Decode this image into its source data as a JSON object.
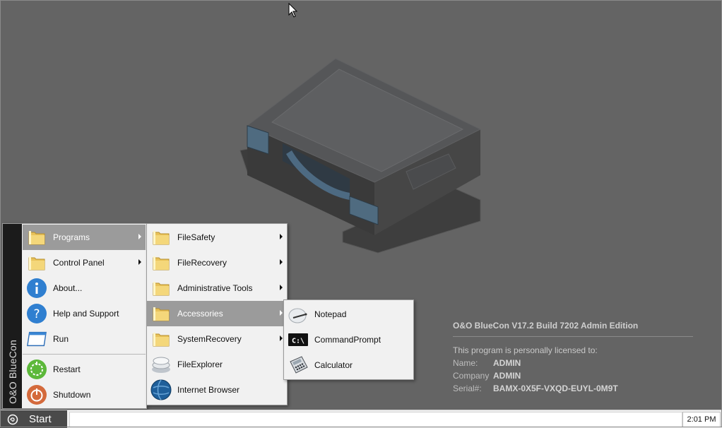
{
  "start_menu": {
    "brand": "O&O BlueCon",
    "items": [
      {
        "label": "Programs",
        "icon": "folder-icon",
        "has_submenu": true,
        "active": true
      },
      {
        "label": "Control Panel",
        "icon": "folder-icon",
        "has_submenu": true
      },
      {
        "label": "About...",
        "icon": "info-icon"
      },
      {
        "label": "Help and Support",
        "icon": "help-icon"
      },
      {
        "label": "Run",
        "icon": "run-window-icon"
      },
      {
        "label": "Restart",
        "icon": "restart-icon"
      },
      {
        "label": "Shutdown",
        "icon": "power-icon"
      }
    ]
  },
  "programs_menu": {
    "items": [
      {
        "label": "FileSafety",
        "icon": "folder-icon",
        "has_submenu": true
      },
      {
        "label": "FileRecovery",
        "icon": "folder-icon",
        "has_submenu": true
      },
      {
        "label": "Administrative Tools",
        "icon": "folder-icon",
        "has_submenu": true
      },
      {
        "label": "Accessories",
        "icon": "folder-icon",
        "has_submenu": true,
        "active": true
      },
      {
        "label": "SystemRecovery",
        "icon": "folder-icon",
        "has_submenu": true
      },
      {
        "label": "FileExplorer",
        "icon": "file-explorer-icon"
      },
      {
        "label": "Internet Browser",
        "icon": "globe-icon"
      }
    ]
  },
  "accessories_menu": {
    "items": [
      {
        "label": "Notepad",
        "icon": "notepad-icon"
      },
      {
        "label": "CommandPrompt",
        "icon": "command-prompt-icon"
      },
      {
        "label": "Calculator",
        "icon": "calculator-icon"
      }
    ]
  },
  "license": {
    "title": "O&O BlueCon V17.2 Build 7202 Admin Edition",
    "licensed_to": "This program is personally licensed to:",
    "name_label": "Name:",
    "name_value": "ADMIN",
    "company_label": "Company",
    "company_value": "ADMIN",
    "serial_label": "Serial#:",
    "serial_value": "BAMX-0X5F-VXQD-EUYL-0M9T"
  },
  "taskbar": {
    "start_label": "Start",
    "clock": "2:01 PM"
  },
  "colors": {
    "desktop": "#646464",
    "menu_bg": "#f1f1f1",
    "menu_active": "#9b9b9b",
    "brand_strip": "#1b1b1b",
    "start_button": "#4a4a4a"
  }
}
